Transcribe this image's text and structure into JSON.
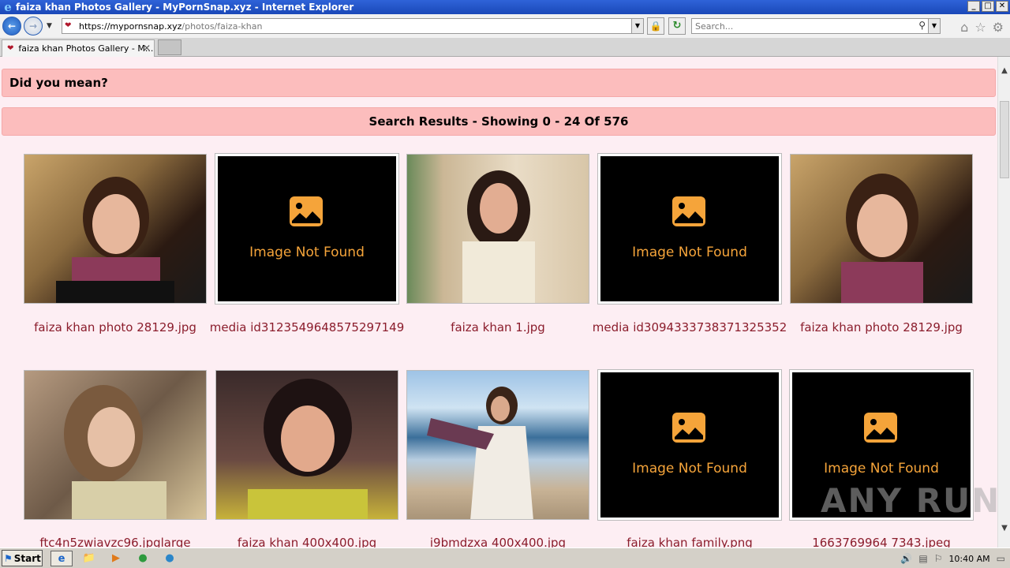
{
  "window": {
    "title": "faiza khan Photos Gallery - MyPornSnap.xyz - Internet Explorer",
    "buttons": [
      "_",
      "□",
      "✕"
    ]
  },
  "navbar": {
    "url_main": "https://mypornsnap.xyz",
    "url_rest": "/photos/faiza-khan",
    "search_placeholder": "Search..."
  },
  "tab": {
    "label": "faiza khan Photos Gallery - M...",
    "close": "✕"
  },
  "page": {
    "did_you_mean": "Did you mean?",
    "results_heading": "Search Results - Showing 0 - 24 Of 576",
    "not_found_text": "Image Not Found",
    "items": [
      {
        "caption": "faiza khan photo 28129.jpg",
        "found": true
      },
      {
        "caption": "media id3123549648575297149",
        "found": false
      },
      {
        "caption": "faiza khan 1.jpg",
        "found": true
      },
      {
        "caption": "media id3094333738371325352",
        "found": false
      },
      {
        "caption": "faiza khan photo 28129.jpg",
        "found": true
      },
      {
        "caption": "ftc4n5zwiavzc96.jpglarge",
        "found": true
      },
      {
        "caption": "faiza khan 400x400.jpg",
        "found": true
      },
      {
        "caption": "i9bmdzxa 400x400.jpg",
        "found": true
      },
      {
        "caption": "faiza khan family.png",
        "found": false
      },
      {
        "caption": "1663769964 7343.jpeg",
        "found": false
      }
    ]
  },
  "watermark": "ANY RUN",
  "taskbar": {
    "start_label": "Start",
    "clock": "10:40 AM"
  },
  "colors": {
    "banner": "#fcbdbd",
    "page_bg": "#fdeef3",
    "caption": "#8b1d2c",
    "not_found_accent": "#f5a43a"
  }
}
